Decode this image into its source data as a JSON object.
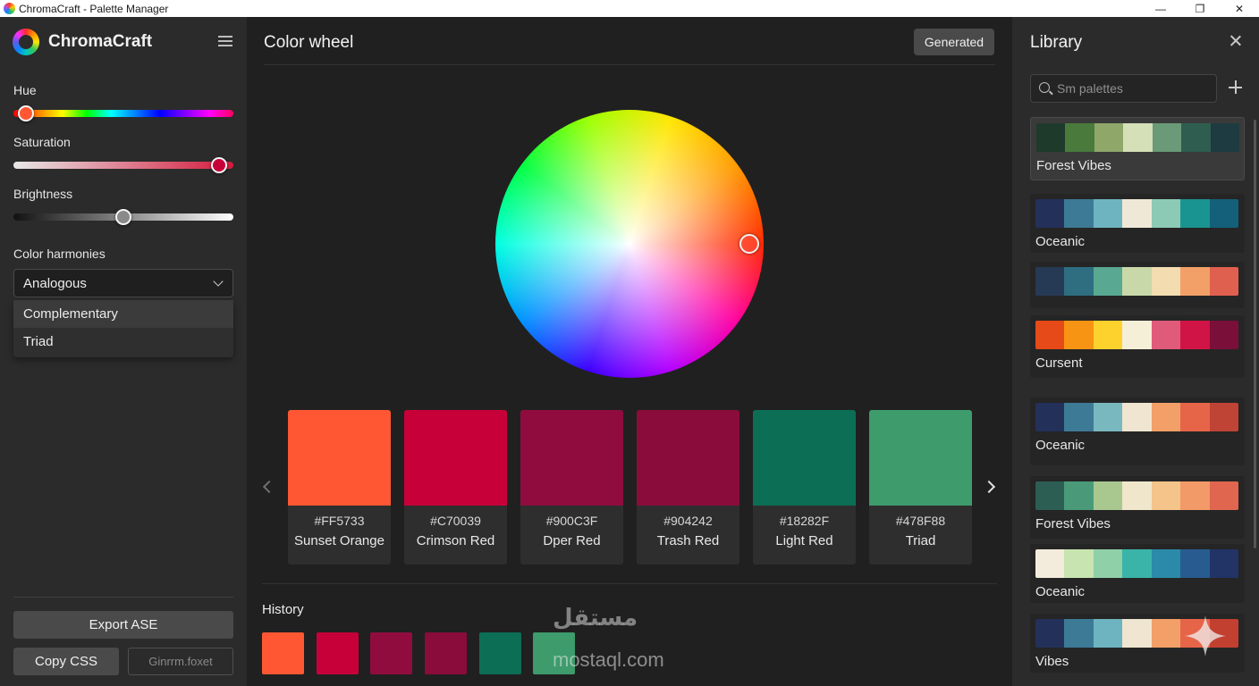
{
  "window": {
    "title": "ChromaCraft - Palette Manager",
    "min": "—",
    "max": "❐",
    "close": "✕"
  },
  "sidebar": {
    "app_name": "ChromaCraft",
    "hue": {
      "label": "Hue",
      "value": 0.02
    },
    "saturation": {
      "label": "Saturation",
      "value": 0.97
    },
    "brightness": {
      "label": "Brightness",
      "value": 0.5
    },
    "harmonies": {
      "label": "Color harmonies",
      "selected": "Analogous",
      "options": [
        "Complementary",
        "Triad"
      ]
    },
    "export_label": "Export ASE",
    "copy_label": "Copy CSS",
    "ghost_label": "Ginrrm.foxet"
  },
  "main": {
    "title": "Color wheel",
    "generated_label": "Generated",
    "swatches": [
      {
        "hex": "#FF5733",
        "name": "Sunset Orange",
        "color": "#ff5733"
      },
      {
        "hex": "#C70039",
        "name": "Crimson Red",
        "color": "#c70039"
      },
      {
        "hex": "#900C3F",
        "name": "Dper Red",
        "color": "#900c3f"
      },
      {
        "hex": "#904242",
        "name": "Trash Red",
        "color": "#8a0c3a"
      },
      {
        "hex": "#18282F",
        "name": "Light Red",
        "color": "#0c6e55"
      },
      {
        "hex": "#478F88",
        "name": "Triad",
        "color": "#3d9b6c"
      }
    ],
    "history_label": "History",
    "history": [
      "#ff5733",
      "#c70039",
      "#900c3f",
      "#8a0c3a",
      "#0c6e55",
      "#3d9b6c"
    ]
  },
  "library": {
    "title": "Library",
    "search_placeholder": "Sm palettes",
    "palettes": [
      {
        "name": "Forest Vibes",
        "colors": [
          "#1e3a2a",
          "#4a7a3c",
          "#8fa86a",
          "#d5e0b8",
          "#6a9a78",
          "#2f5e50",
          "#1d3b40"
        ]
      },
      {
        "name": "Oceanic",
        "colors": [
          "#23305a",
          "#3c7a96",
          "#6db4c0",
          "#efe8d6",
          "#8ccab6",
          "#1a9490",
          "#14607a"
        ]
      },
      {
        "name": "",
        "colors": [
          "#263a56",
          "#2e6e80",
          "#58a892",
          "#c9d8a8",
          "#f2dcb0",
          "#f2a068",
          "#e06050"
        ]
      },
      {
        "name": "Cursent",
        "colors": [
          "#e64a19",
          "#f79414",
          "#fdd22d",
          "#f6efd8",
          "#e05a7a",
          "#d01445",
          "#7a0f3a"
        ]
      },
      {
        "name": "Oceanic",
        "colors": [
          "#23305a",
          "#3c7a96",
          "#7ab8c0",
          "#efe5d0",
          "#f2a068",
          "#e66548",
          "#bf4435"
        ]
      },
      {
        "name": "Forest Vibes",
        "colors": [
          "#2d5e54",
          "#4a9a7a",
          "#a8c890",
          "#efe6cc",
          "#f5c48a",
          "#f29a68",
          "#e06650"
        ]
      },
      {
        "name": "Oceanic",
        "colors": [
          "#f3ecdc",
          "#c8e4b0",
          "#8fd0a8",
          "#3ab4a8",
          "#2a8aa8",
          "#285c90",
          "#223466"
        ]
      },
      {
        "name": "Vibes",
        "colors": [
          "#23305a",
          "#3c7a96",
          "#6db4c0",
          "#efe5d0",
          "#f2a068",
          "#e66548",
          "#c24030"
        ]
      }
    ]
  },
  "watermark": {
    "arabic": "مستقل",
    "latin": "mostaql.com"
  }
}
